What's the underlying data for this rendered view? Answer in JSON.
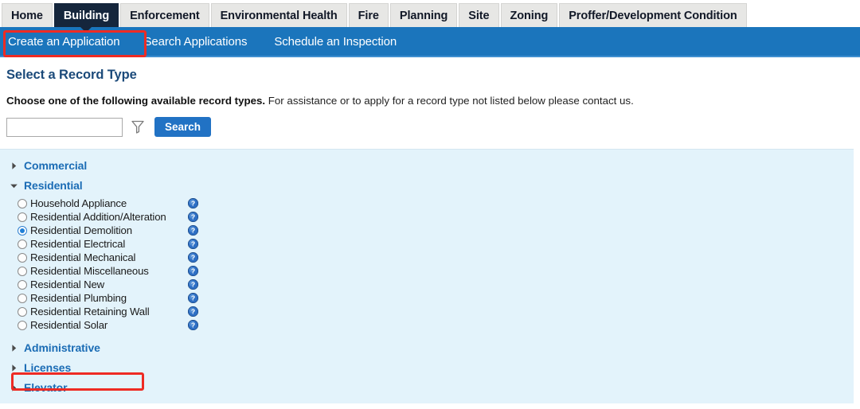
{
  "module_tabs": [
    {
      "label": "Home",
      "active": false
    },
    {
      "label": "Building",
      "active": true
    },
    {
      "label": "Enforcement",
      "active": false
    },
    {
      "label": "Environmental Health",
      "active": false
    },
    {
      "label": "Fire",
      "active": false
    },
    {
      "label": "Planning",
      "active": false
    },
    {
      "label": "Site",
      "active": false
    },
    {
      "label": "Zoning",
      "active": false
    },
    {
      "label": "Proffer/Development Condition",
      "active": false
    }
  ],
  "subnav": {
    "items": [
      {
        "label": "Create an Application",
        "highlighted": true
      },
      {
        "label": "Search Applications",
        "highlighted": false
      },
      {
        "label": "Schedule an Inspection",
        "highlighted": false
      }
    ]
  },
  "page": {
    "title": "Select a Record Type",
    "instructions_bold": "Choose one of the following available record types.",
    "instructions_rest": " For assistance or to apply for a record type not listed below please contact us."
  },
  "search": {
    "value": "",
    "placeholder": "",
    "filter_icon": "funnel-icon",
    "button_label": "Search"
  },
  "record_groups": [
    {
      "label": "Commercial",
      "expanded": false,
      "items": []
    },
    {
      "label": "Residential",
      "expanded": true,
      "items": [
        {
          "label": "Household Appliance",
          "selected": false,
          "help": true
        },
        {
          "label": "Residential Addition/Alteration",
          "selected": false,
          "help": true
        },
        {
          "label": "Residential Demolition",
          "selected": true,
          "help": true
        },
        {
          "label": "Residential Electrical",
          "selected": false,
          "help": true
        },
        {
          "label": "Residential Mechanical",
          "selected": false,
          "help": true
        },
        {
          "label": "Residential Miscellaneous",
          "selected": false,
          "help": true
        },
        {
          "label": "Residential New",
          "selected": false,
          "help": true
        },
        {
          "label": "Residential Plumbing",
          "selected": false,
          "help": true
        },
        {
          "label": "Residential Retaining Wall",
          "selected": false,
          "help": true
        },
        {
          "label": "Residential Solar",
          "selected": false,
          "help": true
        }
      ]
    },
    {
      "label": "Administrative",
      "expanded": false,
      "items": []
    },
    {
      "label": "Licenses",
      "expanded": false,
      "items": []
    },
    {
      "label": "Elevator",
      "expanded": false,
      "items": []
    }
  ],
  "colors": {
    "subnav_blue": "#1b75bc",
    "active_tab": "#15263c",
    "panel_bg": "#e3f3fb",
    "group_link": "#1b6cb5",
    "title_blue": "#1b4a7a",
    "button_blue": "#2172c4",
    "annotation_red": "#ee2b24"
  }
}
